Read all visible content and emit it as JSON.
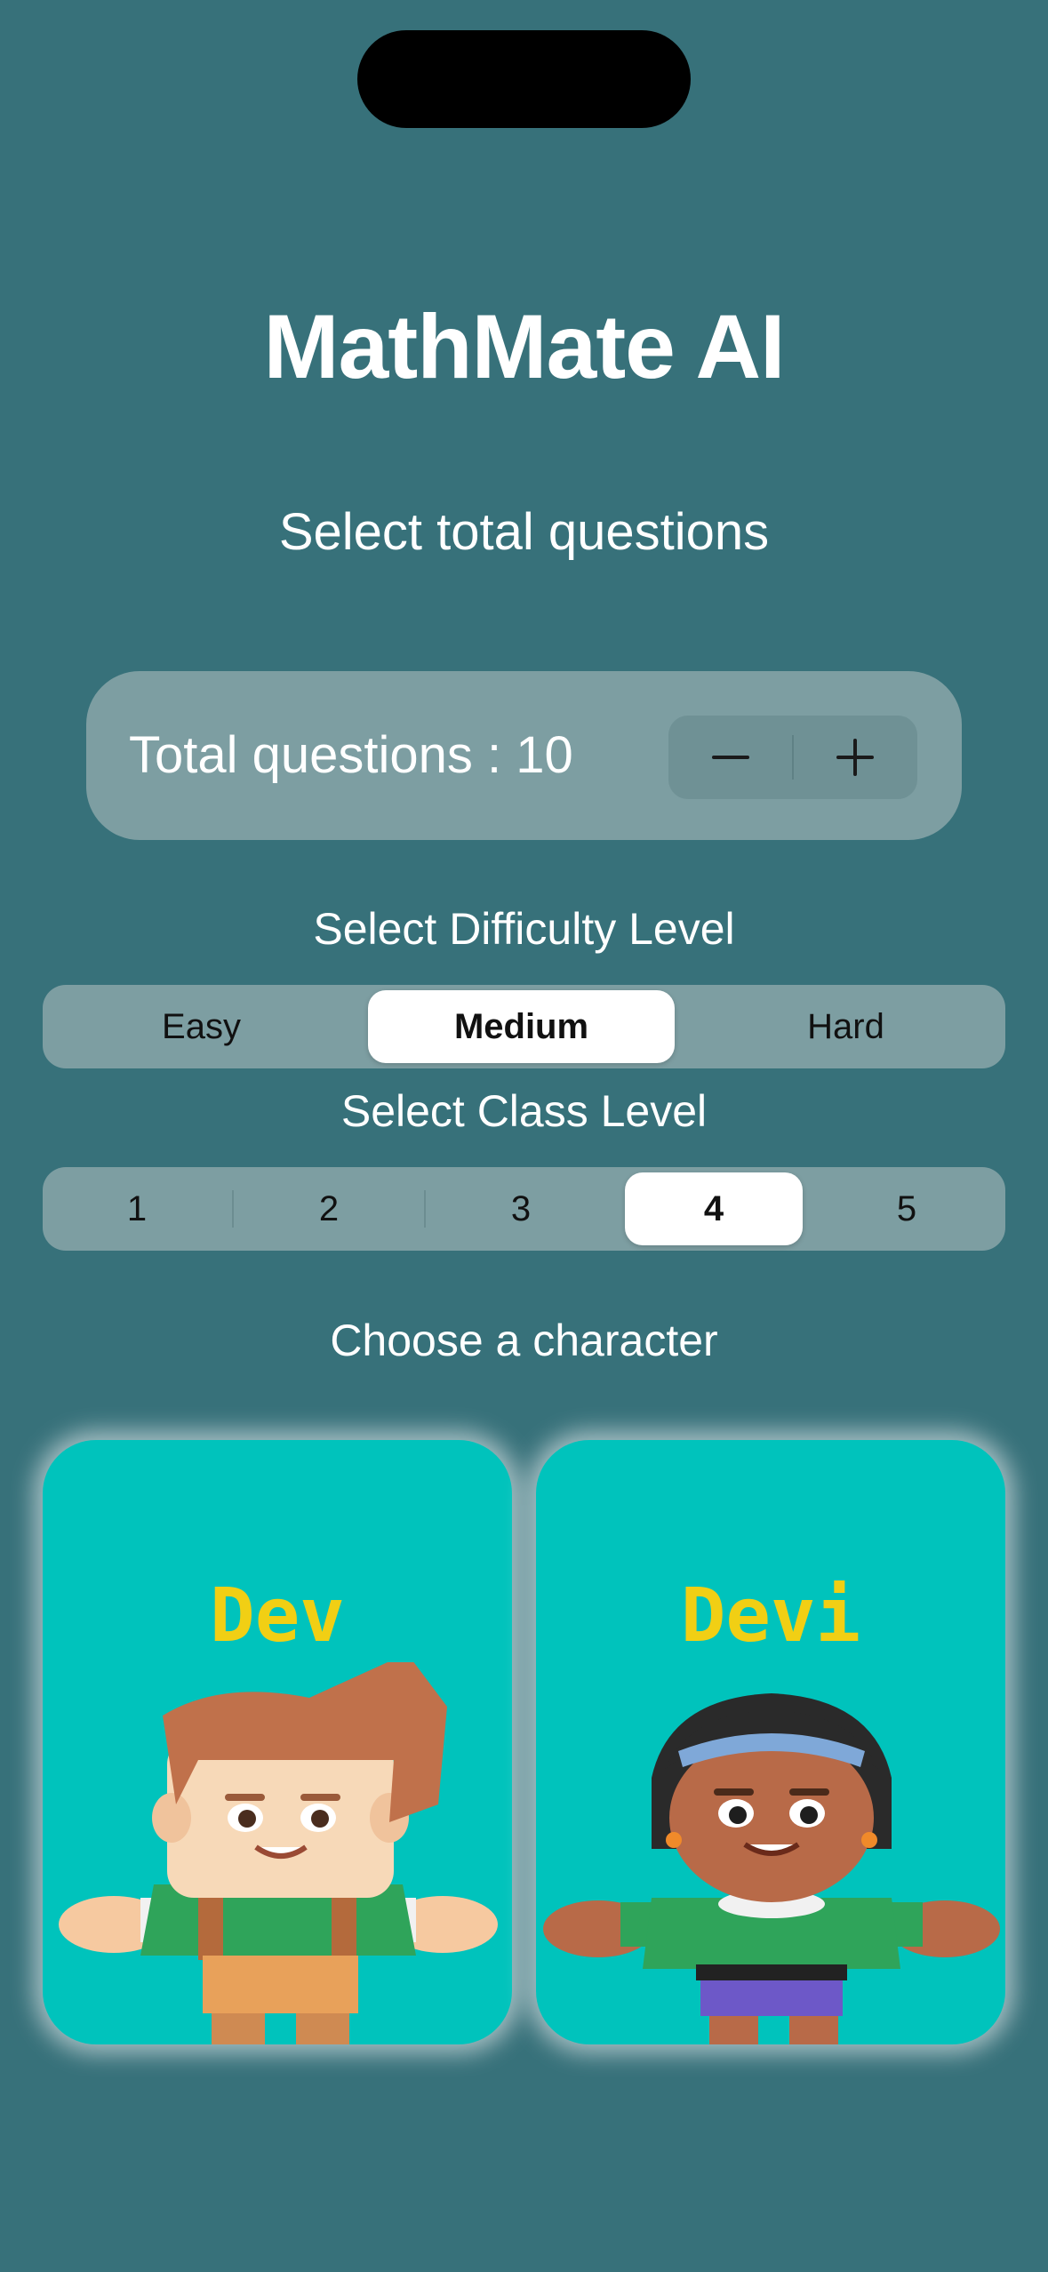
{
  "app": {
    "title": "MathMate AI"
  },
  "questions": {
    "section_label": "Select total questions",
    "total_label": "Total questions : 10",
    "stepper": {
      "decrement_icon": "minus-icon",
      "increment_icon": "plus-icon"
    }
  },
  "difficulty": {
    "section_label": "Select Difficulty Level",
    "options": [
      "Easy",
      "Medium",
      "Hard"
    ],
    "selected": "Medium"
  },
  "class_level": {
    "section_label": "Select Class Level",
    "options": [
      "1",
      "2",
      "3",
      "4",
      "5"
    ],
    "selected": "4"
  },
  "characters": {
    "section_label": "Choose a character",
    "items": [
      {
        "name": "Dev"
      },
      {
        "name": "Devi"
      }
    ]
  },
  "colors": {
    "background": "#37717a",
    "card": "#7d9ea2",
    "character_card": "#00c3bc",
    "character_name": "#f1cf14",
    "selected_segment": "#ffffff"
  }
}
